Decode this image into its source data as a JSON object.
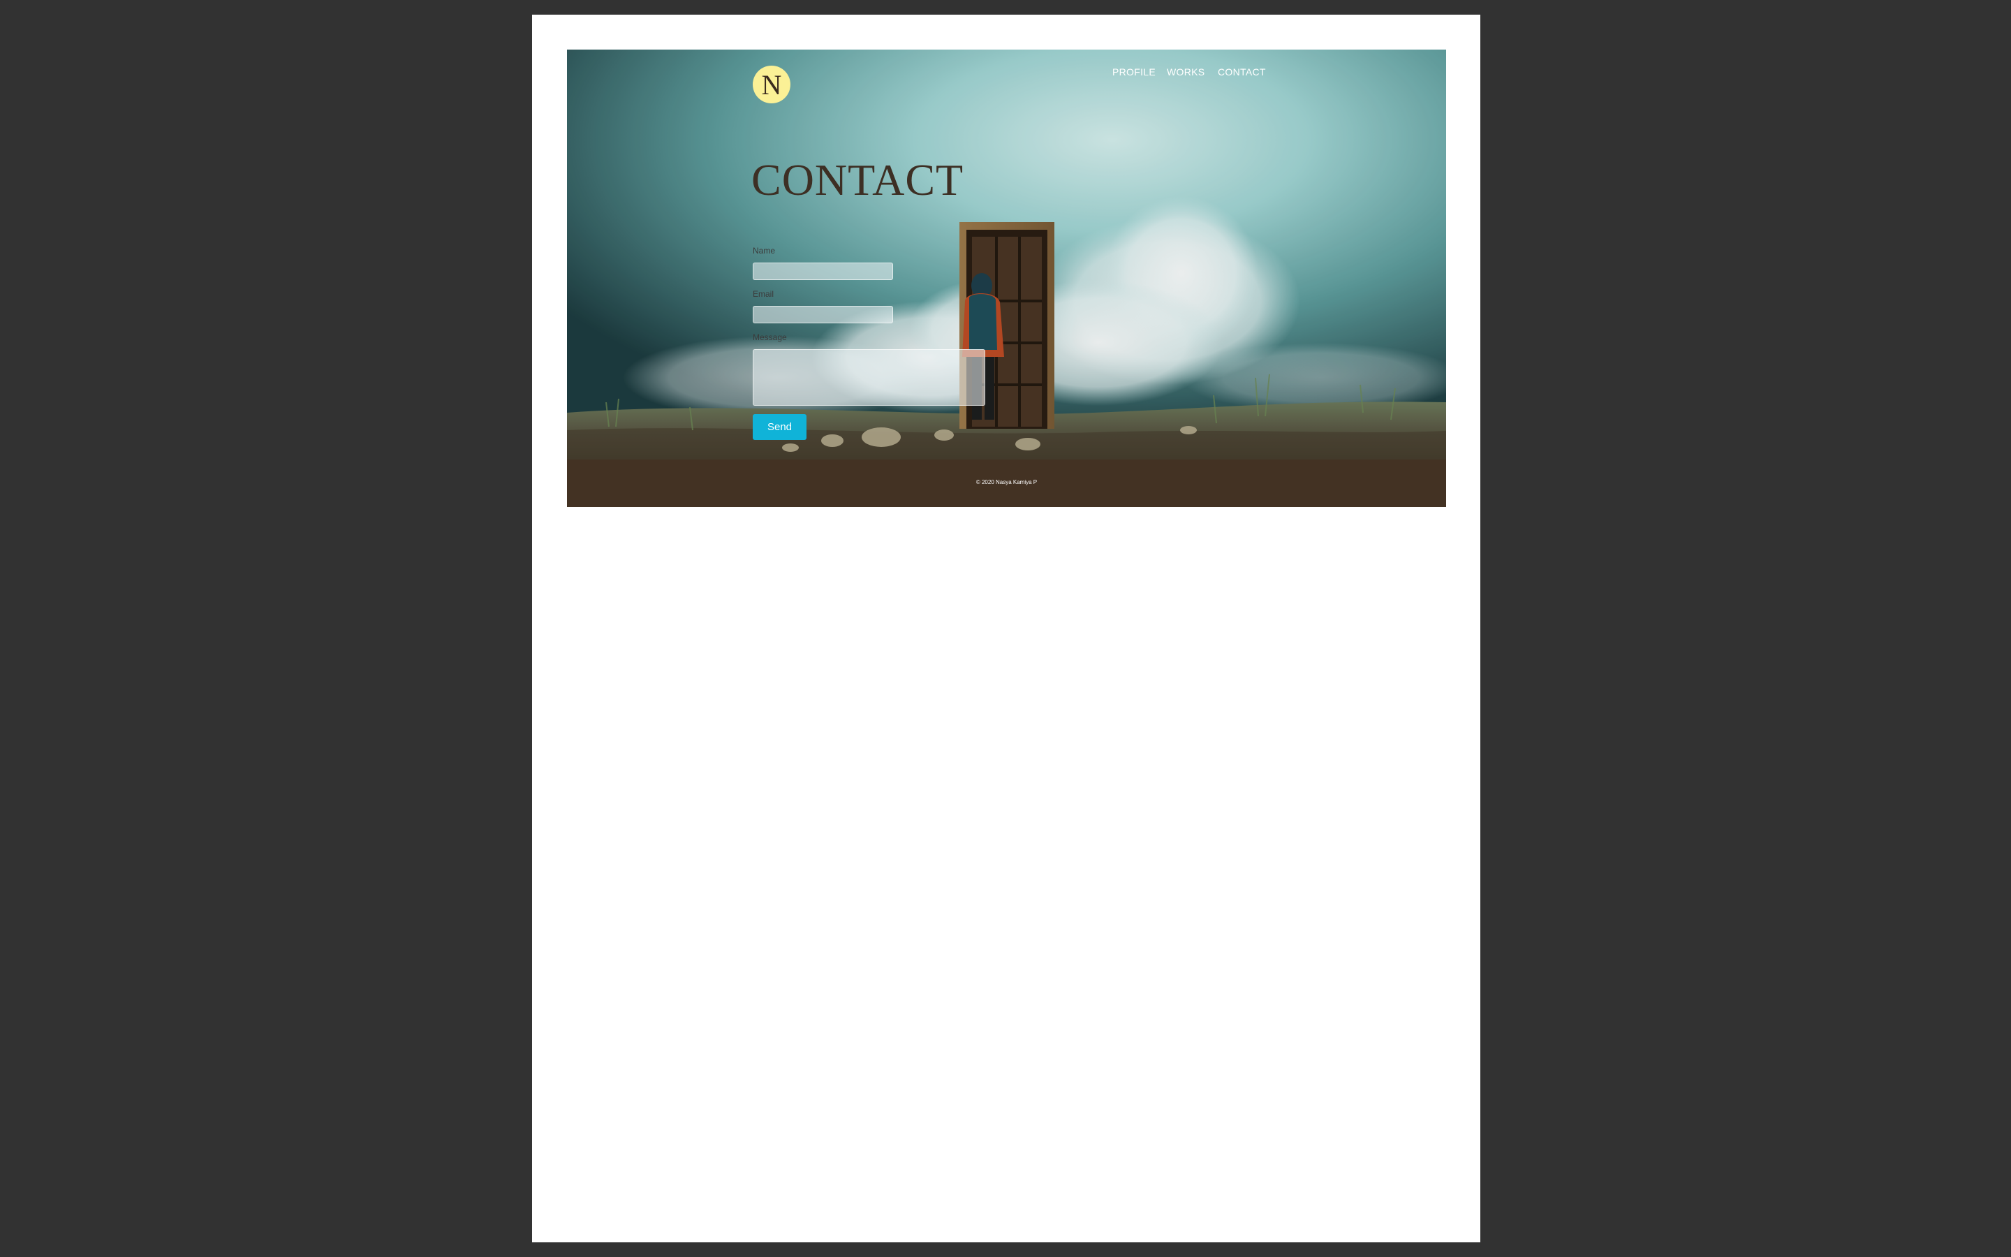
{
  "brand": {
    "logo_letter": "N"
  },
  "nav": {
    "items": [
      {
        "label": "PROFILE"
      },
      {
        "label": "WORKS"
      },
      {
        "label": "CONTACT"
      }
    ]
  },
  "hero": {
    "image": "person-with-backpack-at-door-in-clouds",
    "title": "CONTACT"
  },
  "form": {
    "name_label": "Name",
    "name_value": "",
    "email_label": "Email",
    "email_value": "",
    "message_label": "Message",
    "message_value": "",
    "send_label": "Send"
  },
  "footer": {
    "copyright": "© 2020 Nasya Kamiya P"
  },
  "colors": {
    "page_background": "#323232",
    "logo_fill": "#fbf196",
    "title_text": "#3d2f24",
    "send_button": "#10b3d8",
    "footer_background": "#433223"
  }
}
